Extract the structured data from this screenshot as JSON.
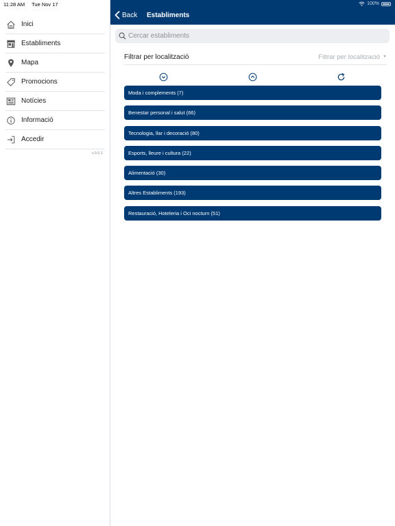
{
  "status": {
    "time": "11:28 AM",
    "date": "Tue Nov 17",
    "battery": "100%"
  },
  "sidebar": {
    "items": [
      {
        "label": "Inici",
        "icon": "home-icon"
      },
      {
        "label": "Establiments",
        "icon": "store-icon"
      },
      {
        "label": "Mapa",
        "icon": "map-pin-icon"
      },
      {
        "label": "Promocions",
        "icon": "tag-icon"
      },
      {
        "label": "Notícies",
        "icon": "newspaper-icon"
      },
      {
        "label": "Informació",
        "icon": "info-icon"
      },
      {
        "label": "Accedir",
        "icon": "login-icon"
      }
    ],
    "version": "v.9.0.1"
  },
  "navbar": {
    "back_label": "Back",
    "title": "Establiments"
  },
  "search": {
    "placeholder": "Cercar establiments"
  },
  "filter": {
    "label": "Filtrar per localització",
    "placeholder": "Filtrar per localització"
  },
  "categories": [
    "Moda i complements (7)",
    "Benestar personal i salut (66)",
    "Tecnologia, llar i decoració (80)",
    "Esports, lleure i cultura (22)",
    "Alimentació (30)",
    "Altres Establiments (193)",
    "Restauració, Hoteleria i Oci nocturn (51)"
  ],
  "colors": {
    "primary": "#003a72",
    "sidebar_bg": "#ffffff",
    "divider": "#e1e4e8"
  }
}
